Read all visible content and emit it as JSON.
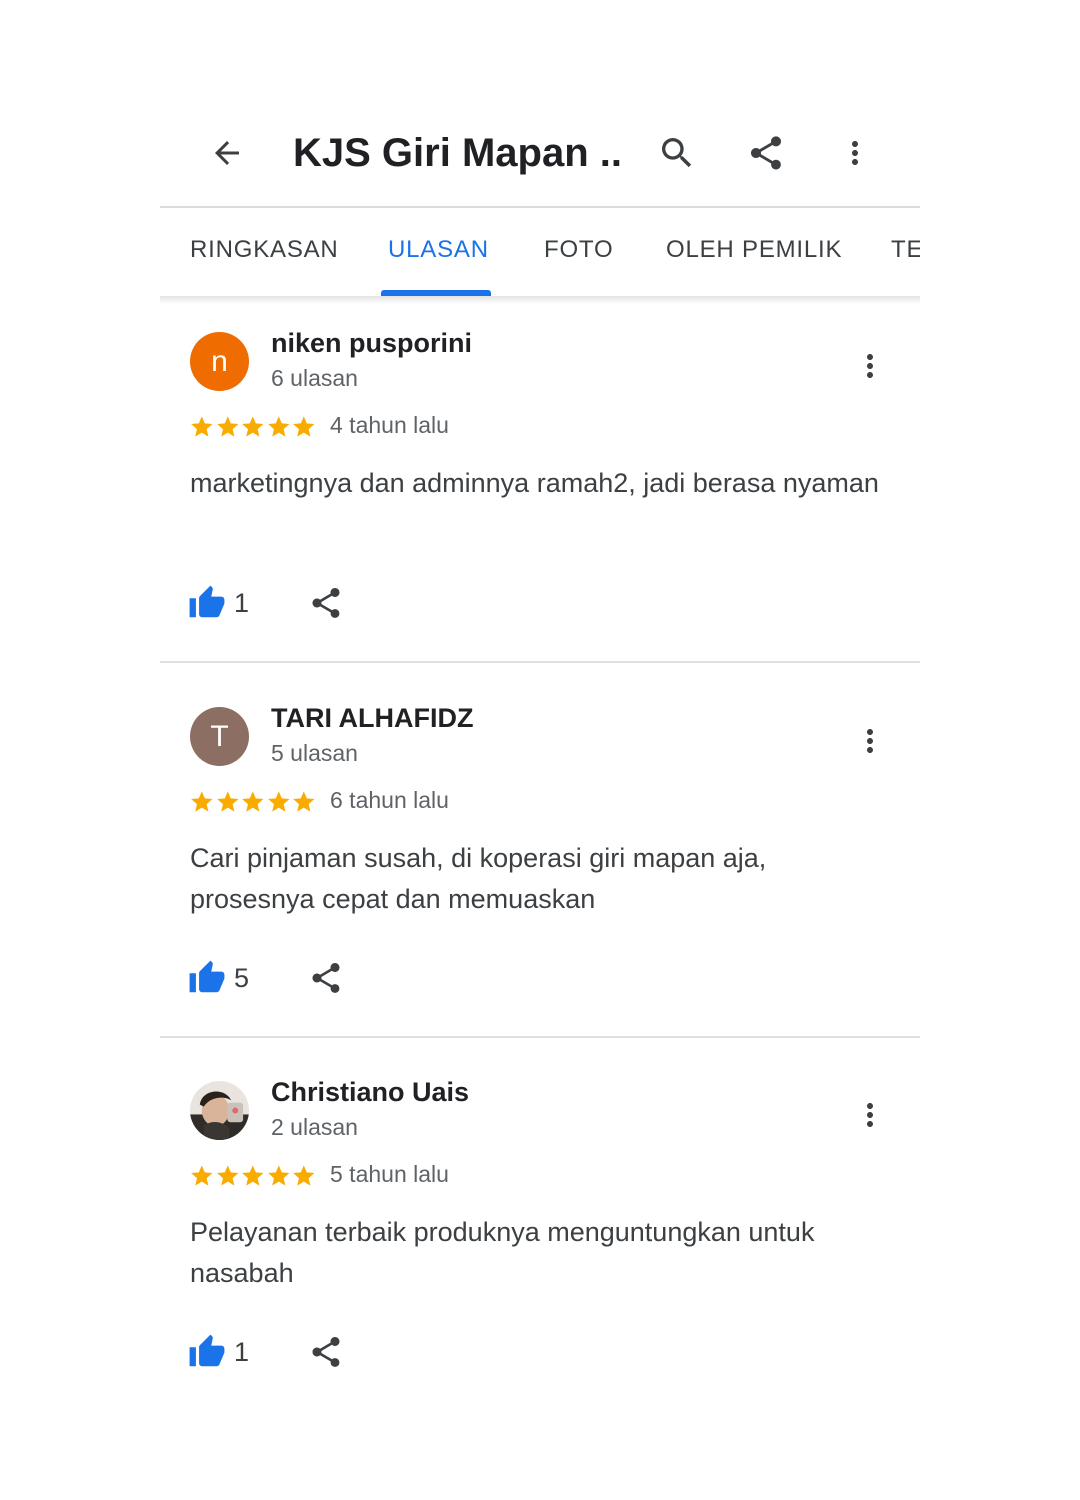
{
  "header": {
    "title": "KJS Giri Mapan ...",
    "back_icon": "arrow-left-icon",
    "search_icon": "search-icon",
    "share_icon": "share-icon",
    "more_icon": "more-vert-icon"
  },
  "tabs": [
    {
      "label": "RINGKASAN",
      "active": false
    },
    {
      "label": "ULASAN",
      "active": true
    },
    {
      "label": "FOTO",
      "active": false
    },
    {
      "label": "OLEH PEMILIK",
      "active": false
    },
    {
      "label": "TE",
      "active": false
    }
  ],
  "reviews": [
    {
      "avatar_letter": "n",
      "avatar_color": "#ef6c00",
      "name": "niken pusporini",
      "count": "6 ulasan",
      "rating": 5,
      "time": "4 tahun lalu",
      "text": "marketingnya dan adminnya ramah2, jadi berasa nyaman",
      "likes": "1"
    },
    {
      "avatar_letter": "T",
      "avatar_color": "#8d6e63",
      "name": "TARI ALHAFIDZ",
      "count": "5 ulasan",
      "rating": 5,
      "time": "6 tahun lalu",
      "text": "Cari pinjaman susah, di koperasi giri mapan aja, prosesnya cepat dan memuaskan",
      "likes": "5"
    },
    {
      "avatar_letter": "",
      "avatar_color": "#4e4a44",
      "avatar_is_photo": true,
      "name": "Christiano Uais",
      "count": "2 ulasan",
      "rating": 5,
      "time": "5 tahun lalu",
      "text": "Pelayanan terbaik produknya menguntungkan untuk nasabah",
      "likes": "1"
    }
  ],
  "colors": {
    "accent": "#1a73e8",
    "star": "#f9ab00"
  }
}
